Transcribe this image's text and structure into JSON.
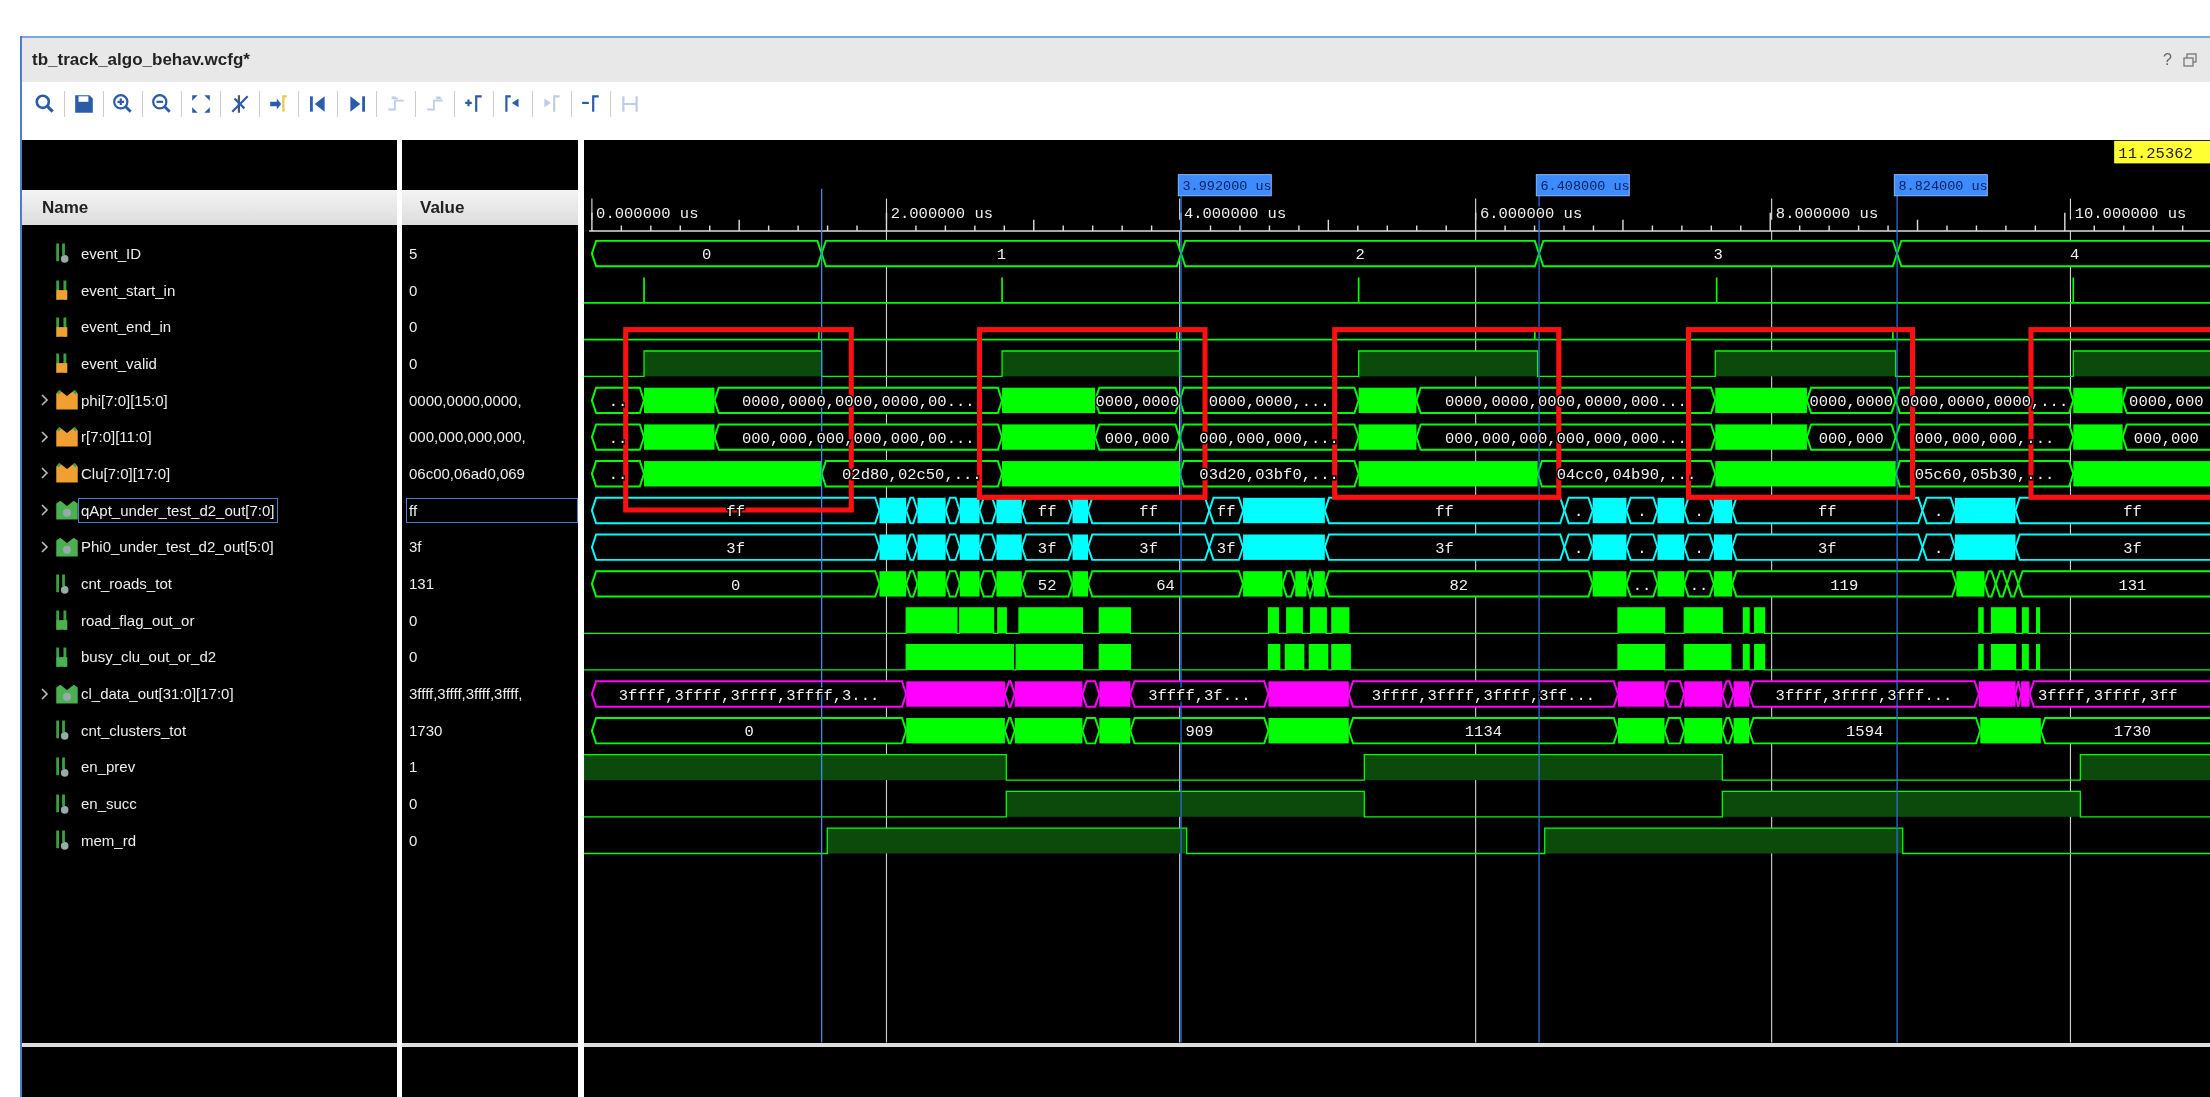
{
  "title": "tb_track_algo_behav.wcfg*",
  "help": "?",
  "toolbar": [
    {
      "kind": "search",
      "disabled": false
    },
    {
      "kind": "save",
      "disabled": false
    },
    {
      "kind": "zoom_in",
      "disabled": false
    },
    {
      "kind": "zoom_out",
      "disabled": false
    },
    {
      "kind": "zoom_fit",
      "disabled": false
    },
    {
      "kind": "cursor_cut",
      "disabled": false
    },
    {
      "kind": "go_to_cursor",
      "disabled": false
    },
    {
      "kind": "go_to_start",
      "disabled": false
    },
    {
      "kind": "go_to_end",
      "disabled": false
    },
    {
      "kind": "prev_transition",
      "disabled": true
    },
    {
      "kind": "next_transition",
      "disabled": true
    },
    {
      "kind": "add_marker",
      "disabled": false
    },
    {
      "kind": "prev_marker",
      "disabled": false
    },
    {
      "kind": "next_marker",
      "disabled": true
    },
    {
      "kind": "delete_marker",
      "disabled": false
    },
    {
      "kind": "swap_cursors",
      "disabled": true
    }
  ],
  "columns": [
    "Name",
    "Value"
  ],
  "cursor_time": "11.25362",
  "markers": [
    "3.992000 us",
    "6.408000 us",
    "8.824000 us"
  ],
  "ruler": [
    "0.000000 us",
    "2.000000 us",
    "4.000000 us",
    "6.000000 us",
    "8.000000 us",
    "10.000000 us"
  ],
  "signals": [
    {
      "name": "event_ID",
      "value": "5",
      "kind": "int",
      "selected": false,
      "color": "#00ff00",
      "wave_labels": [
        "0",
        "1",
        "2",
        "3",
        "4"
      ]
    },
    {
      "name": "event_start_in",
      "value": "0",
      "kind": "bit_in",
      "selected": false,
      "color": "#00ff00"
    },
    {
      "name": "event_end_in",
      "value": "0",
      "kind": "bit_in",
      "selected": false,
      "color": "#00ff00"
    },
    {
      "name": "event_valid",
      "value": "0",
      "kind": "bit_in",
      "selected": false,
      "color": "#00ff00"
    },
    {
      "name": "phi[7:0][15:0]",
      "value": "0000,0000,0000,",
      "kind": "bus_in",
      "expanded": false,
      "selected": false,
      "color": "#00ff00",
      "wave_labels": [
        "..",
        "0000,0000,0000,0000,00...",
        "0000,0000",
        "0000,0000,...",
        "0000,0000,0000,0000,000...",
        "0000,0000",
        "0000,0000,0000,...",
        "0000,000"
      ]
    },
    {
      "name": "r[7:0][11:0]",
      "value": "000,000,000,000,",
      "kind": "bus_in",
      "expanded": false,
      "selected": false,
      "color": "#00ff00",
      "wave_labels": [
        "..",
        "000,000,000,000,000,00...",
        "000,000",
        "000,000,000,...",
        "000,000,000,000,000,000...",
        "000,000",
        "000,000,000,...",
        "000,000"
      ]
    },
    {
      "name": "Clu[7:0][17:0]",
      "value": "06c00,06ad0,069",
      "kind": "bus_in",
      "expanded": false,
      "selected": false,
      "color": "#00ff00",
      "wave_labels": [
        "..",
        "02d80,02c50,...",
        "03d20,03bf0,...",
        "04cc0,04b90,...",
        "05c60,05b30,..."
      ]
    },
    {
      "name": "qApt_under_test_d2_out[7:0]",
      "value": "ff",
      "kind": "bus",
      "expanded": false,
      "selected": true,
      "color": "#00ffff",
      "wave_labels": [
        "ff",
        "ff",
        "ff",
        "ff",
        "ff",
        ".",
        ".",
        ".",
        "ff",
        ".",
        "ff"
      ]
    },
    {
      "name": "Phi0_under_test_d2_out[5:0]",
      "value": "3f",
      "kind": "bus",
      "expanded": false,
      "selected": false,
      "color": "#00ffff",
      "wave_labels": [
        "3f",
        "3f",
        "3f",
        "3f",
        "3f",
        ".",
        ".",
        ".",
        "3f",
        ".",
        "3f"
      ]
    },
    {
      "name": "cnt_roads_tot",
      "value": "131",
      "kind": "int",
      "selected": false,
      "color": "#00ff00",
      "wave_labels": [
        "0",
        "52",
        "64",
        "82",
        "..",
        "..",
        "119",
        "131"
      ]
    },
    {
      "name": "road_flag_out_or",
      "value": "0",
      "kind": "bit",
      "selected": false,
      "color": "#00ff00"
    },
    {
      "name": "busy_clu_out_or_d2",
      "value": "0",
      "kind": "bit",
      "selected": false,
      "color": "#00ff00"
    },
    {
      "name": "cl_data_out[31:0][17:0]",
      "value": "3ffff,3ffff,3ffff,3ffff,",
      "kind": "bus",
      "expanded": false,
      "selected": false,
      "color": "#ff00ff",
      "wave_labels": [
        "3ffff,3ffff,3ffff,3ffff,3...",
        "3ffff,3f...",
        "3ffff,3ffff,3ffff,3ff...",
        "3ffff,3ffff,3fff...",
        "3ffff,3ffff,3ff"
      ]
    },
    {
      "name": "cnt_clusters_tot",
      "value": "1730",
      "kind": "int",
      "selected": false,
      "color": "#00ff00",
      "wave_labels": [
        "0",
        "909",
        "1134",
        "1594",
        "1730"
      ]
    },
    {
      "name": "en_prev",
      "value": "1",
      "kind": "int",
      "selected": false,
      "color": "#00ff00"
    },
    {
      "name": "en_succ",
      "value": "0",
      "kind": "int",
      "selected": false,
      "color": "#00ff00"
    },
    {
      "name": "mem_rd",
      "value": "0",
      "kind": "int",
      "selected": false,
      "color": "#00ff00"
    }
  ]
}
